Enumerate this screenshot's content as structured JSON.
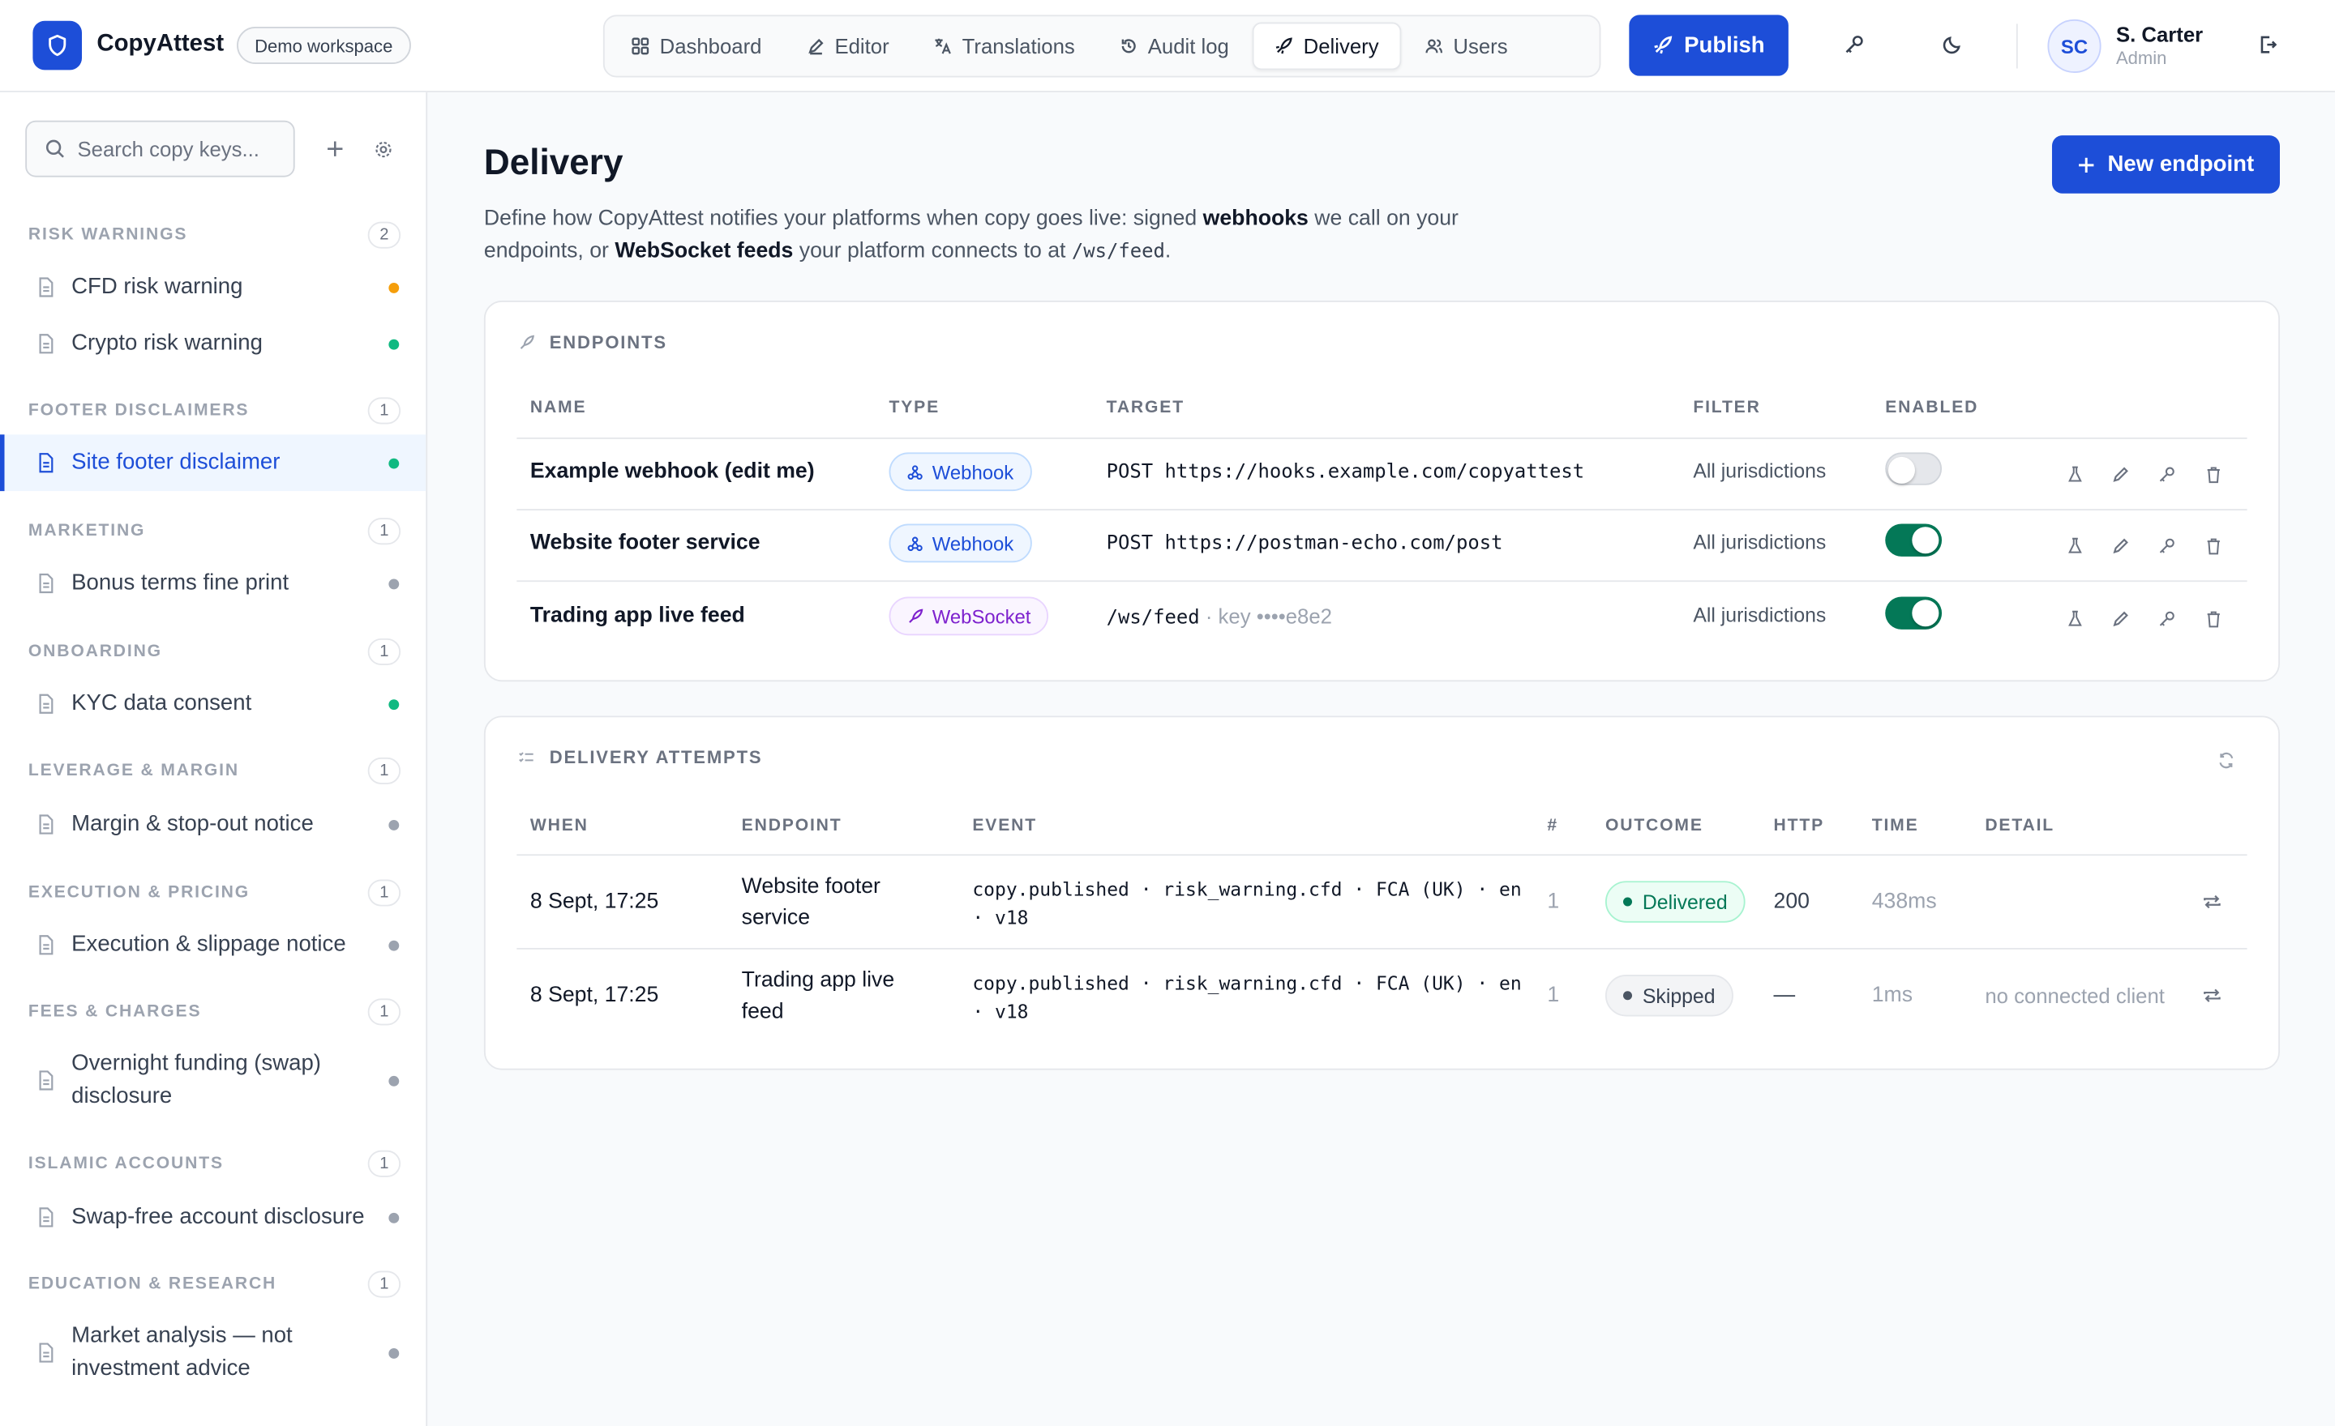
{
  "app": {
    "name": "CopyAttest",
    "workspace": "Demo workspace"
  },
  "nav": {
    "tabs": [
      {
        "label": "Dashboard",
        "icon": "grid-icon"
      },
      {
        "label": "Editor",
        "icon": "edit-icon"
      },
      {
        "label": "Translations",
        "icon": "translate-icon"
      },
      {
        "label": "Audit log",
        "icon": "history-icon"
      },
      {
        "label": "Delivery",
        "icon": "rocket-icon",
        "active": true
      },
      {
        "label": "Users",
        "icon": "users-icon"
      }
    ],
    "publish_label": "Publish"
  },
  "user": {
    "initials": "SC",
    "name": "S. Carter",
    "role": "Admin"
  },
  "sidebar": {
    "search_placeholder": "Search copy keys...",
    "groups": [
      {
        "title": "RISK WARNINGS",
        "count": "2",
        "items": [
          {
            "label": "CFD risk warning",
            "status_color": "#f59e0b"
          },
          {
            "label": "Crypto risk warning",
            "status_color": "#10b981"
          }
        ]
      },
      {
        "title": "FOOTER DISCLAIMERS",
        "count": "1",
        "items": [
          {
            "label": "Site footer disclaimer",
            "status_color": "#10b981",
            "active": true
          }
        ]
      },
      {
        "title": "MARKETING",
        "count": "1",
        "items": [
          {
            "label": "Bonus terms fine print",
            "status_color": "#9ca3af"
          }
        ]
      },
      {
        "title": "ONBOARDING",
        "count": "1",
        "items": [
          {
            "label": "KYC data consent",
            "status_color": "#10b981"
          }
        ]
      },
      {
        "title": "LEVERAGE & MARGIN",
        "count": "1",
        "items": [
          {
            "label": "Margin & stop-out notice",
            "status_color": "#9ca3af"
          }
        ]
      },
      {
        "title": "EXECUTION & PRICING",
        "count": "1",
        "items": [
          {
            "label": "Execution & slippage notice",
            "status_color": "#9ca3af"
          }
        ]
      },
      {
        "title": "FEES & CHARGES",
        "count": "1",
        "items": [
          {
            "label": "Overnight funding (swap) disclosure",
            "status_color": "#9ca3af"
          }
        ]
      },
      {
        "title": "ISLAMIC ACCOUNTS",
        "count": "1",
        "items": [
          {
            "label": "Swap-free account disclosure",
            "status_color": "#9ca3af"
          }
        ]
      },
      {
        "title": "EDUCATION & RESEARCH",
        "count": "1",
        "items": [
          {
            "label": "Market analysis — not investment advice",
            "status_color": "#9ca3af"
          }
        ]
      }
    ]
  },
  "page": {
    "title": "Delivery",
    "desc_1": "Define how CopyAttest notifies your platforms when copy goes live: signed ",
    "desc_b1": "webhooks",
    "desc_2": " we call on your endpoints, or ",
    "desc_b2": "WebSocket feeds",
    "desc_3": " your platform connects to at ",
    "desc_code": "/ws/feed",
    "desc_4": ".",
    "new_endpoint_label": "New endpoint"
  },
  "endpoints": {
    "title": "ENDPOINTS",
    "columns": [
      "NAME",
      "TYPE",
      "TARGET",
      "FILTER",
      "ENABLED"
    ],
    "rows": [
      {
        "name": "Example webhook (edit me)",
        "type": "Webhook",
        "method": "POST",
        "target": "https://hooks.example.com/copyattest",
        "target_extra": "",
        "filter": "All jurisdictions",
        "enabled": false
      },
      {
        "name": "Website footer service",
        "type": "Webhook",
        "method": "POST",
        "target": "https://postman-echo.com/post",
        "target_extra": "",
        "filter": "All jurisdictions",
        "enabled": true
      },
      {
        "name": "Trading app live feed",
        "type": "WebSocket",
        "method": "",
        "target": "/ws/feed",
        "target_extra": "· key ••••e8e2",
        "filter": "All jurisdictions",
        "enabled": true
      }
    ]
  },
  "attempts": {
    "title": "DELIVERY ATTEMPTS",
    "columns": [
      "WHEN",
      "ENDPOINT",
      "EVENT",
      "#",
      "OUTCOME",
      "HTTP",
      "TIME",
      "DETAIL"
    ],
    "rows": [
      {
        "when": "8 Sept, 17:25",
        "endpoint_l1": "Website footer",
        "endpoint_l2": "service",
        "event_l1": "copy.published · risk_warning.cfd · FCA (UK) · en",
        "event_l2": "· v18",
        "n": "1",
        "outcome": "Delivered",
        "http": "200",
        "time": "438ms",
        "detail": ""
      },
      {
        "when": "8 Sept, 17:25",
        "endpoint_l1": "Trading app live",
        "endpoint_l2": "feed",
        "event_l1": "copy.published · risk_warning.cfd · FCA (UK) · en",
        "event_l2": "· v18",
        "n": "1",
        "outcome": "Skipped",
        "http": "—",
        "time": "1ms",
        "detail": "no connected client"
      }
    ]
  },
  "colors": {
    "accent": "#1d4ed8",
    "success": "#047857",
    "warning": "#f59e0b"
  }
}
